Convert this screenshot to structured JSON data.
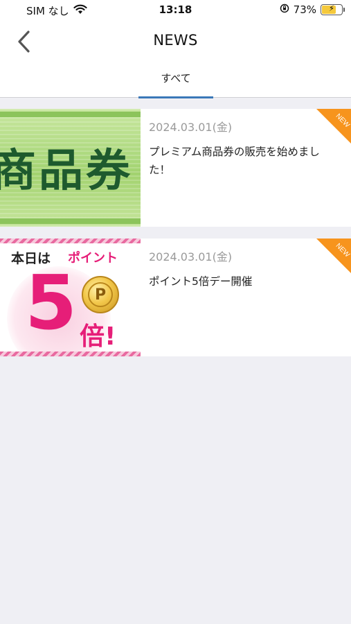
{
  "status_bar": {
    "carrier": "SIM なし",
    "time": "13:18",
    "battery_percent": "73%",
    "battery_level": 0.73,
    "icons": [
      "wifi-icon",
      "orientation-lock-icon",
      "battery-charging-icon"
    ]
  },
  "nav": {
    "title": "NEWS",
    "back_icon": "chevron-left-icon"
  },
  "tabs": [
    {
      "label": "すべて",
      "active": true
    }
  ],
  "colors": {
    "accent": "#3a78b8",
    "new_badge": "#f7941d",
    "background": "#efeff4",
    "date_text": "#9a9a9a"
  },
  "news": [
    {
      "date": "2024.03.01(金)",
      "title": "プレミアム商品券の販売を始めました！",
      "badge": "NEW",
      "thumbnail": {
        "text": "商品券"
      }
    },
    {
      "date": "2024.03.01(金)",
      "title": "ポイント5倍デー開催",
      "badge": "NEW",
      "thumbnail": {
        "line1": "本日は",
        "line1_accent": "ポイント",
        "number": "5",
        "suffix": "倍!",
        "coin": "P"
      }
    }
  ]
}
